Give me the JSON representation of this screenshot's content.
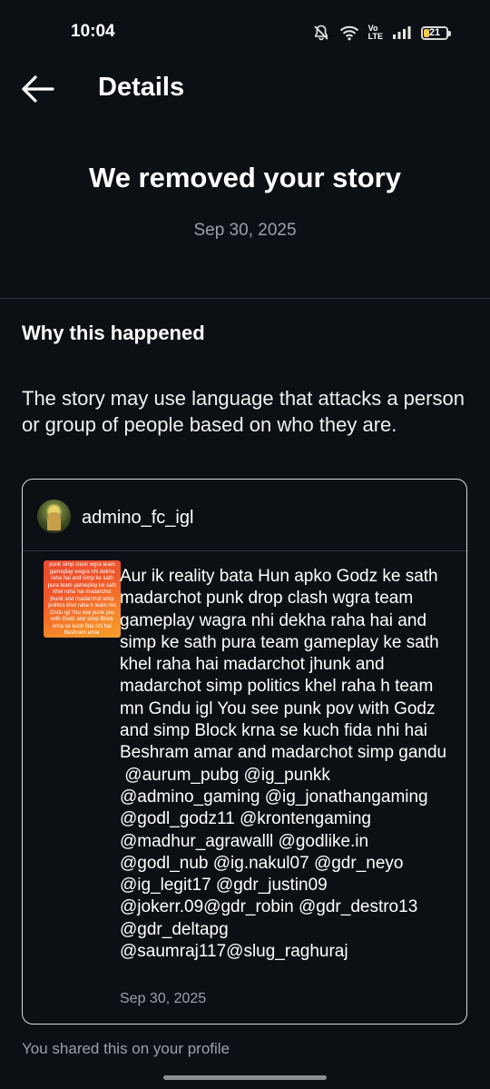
{
  "status_bar": {
    "time": "10:04",
    "volte_top": "Vo",
    "volte_bottom": "LTE",
    "battery": "21"
  },
  "header": {
    "title": "Details"
  },
  "notice": {
    "headline": "We removed your story",
    "date": "Sep 30, 2025"
  },
  "reason": {
    "title": "Why this happened",
    "text": "The story may use language that attacks a person or group of people based on who they are."
  },
  "story": {
    "username": "admino_fc_igl",
    "thumbnail_text": "punk simp clash wgra team gameplay wagra nhi dekha raha hai and simp ke sath pura team gameplay ke sath khel raha hai madarchot jhunk and madarchot simp politics khel raha h team mn Gndu igl You see punk pov with Godz and simp Block krna se kuch fida nhi hai Beshram amar",
    "caption": "Aur ik reality bata Hun apko Godz ke sath madarchot punk drop clash wgra team gameplay wagra nhi dekha raha hai and simp ke sath pura team gameplay ke sath khel raha hai madarchot jhunk and madarchot simp politics khel raha h team mn Gndu igl You see punk pov with Godz and simp Block krna se kuch fida nhi hai Beshram amar and madarchot simp gandu\n @aurum_pubg @ig_punkk @admino_gaming @ig_jonathangaming @godl_godz11 @krontengaming @madhur_agrawalll @godlike.in @godl_nub @ig.nakul07 @gdr_neyo @ig_legit17 @gdr_justin09 @jokerr.09@gdr_robin @gdr_destro13 @gdr_deltapg @saumraj117@slug_raghuraj",
    "date": "Sep 30, 2025"
  },
  "footer": {
    "note": "You shared this on your profile"
  }
}
